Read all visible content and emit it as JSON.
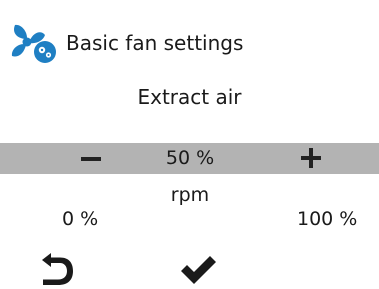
{
  "header": {
    "title": "Basic fan settings",
    "icon": "fan-settings-icon",
    "icon_color": "#1f7fc3"
  },
  "subtitle": "Extract air",
  "slider": {
    "value": "50 %",
    "unit": "rpm",
    "min_label": "0 %",
    "max_label": "100 %",
    "decrease_icon": "minus-icon",
    "increase_icon": "plus-icon",
    "bar_color": "#b3b3b3"
  },
  "footer": {
    "back_icon": "back-arrow-icon",
    "confirm_icon": "checkmark-icon"
  }
}
